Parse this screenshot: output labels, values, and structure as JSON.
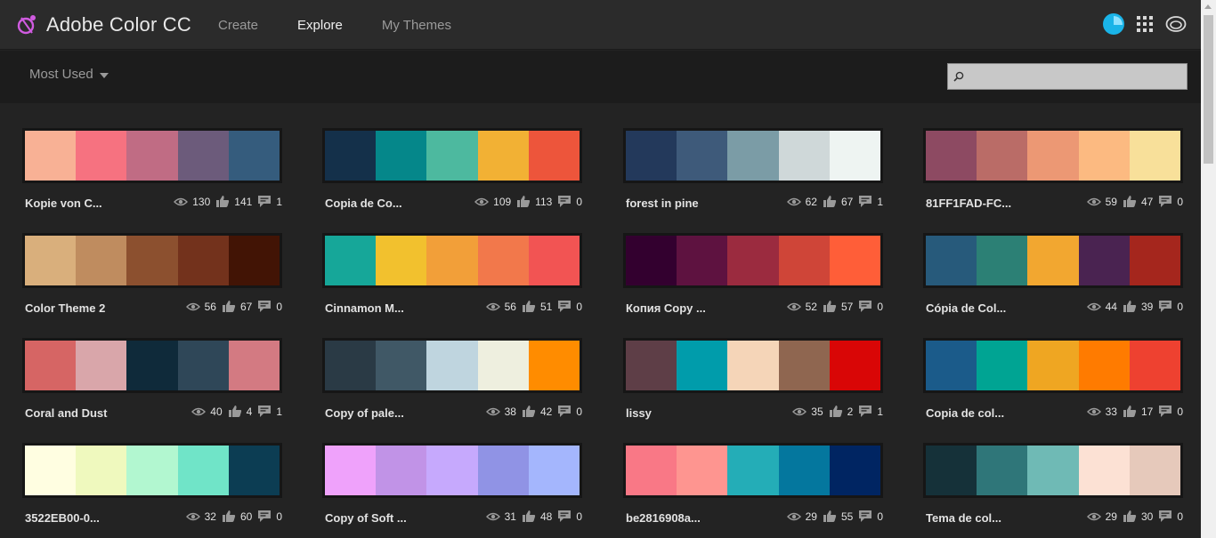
{
  "app": {
    "title": "Adobe Color CC",
    "nav": [
      {
        "label": "Create",
        "active": false
      },
      {
        "label": "Explore",
        "active": true
      },
      {
        "label": "My Themes",
        "active": false
      }
    ]
  },
  "toolbar": {
    "sort_label": "Most Used",
    "search_value": ""
  },
  "themes": [
    {
      "title": "Kopie von C...",
      "views": "130",
      "likes": "141",
      "comments": "1",
      "colors": [
        "#F8B195",
        "#F67280",
        "#C06C84",
        "#6C5B7B",
        "#355C7D"
      ]
    },
    {
      "title": "Copia de Co...",
      "views": "109",
      "likes": "113",
      "comments": "0",
      "colors": [
        "#14304A",
        "#05878A",
        "#4DB99F",
        "#F2B134",
        "#ED553B"
      ]
    },
    {
      "title": "forest in pine",
      "views": "62",
      "likes": "67",
      "comments": "1",
      "colors": [
        "#23395B",
        "#3E5A7A",
        "#7B9CA6",
        "#CFD8D9",
        "#EEF4F2"
      ]
    },
    {
      "title": "81FF1FAD-FC...",
      "views": "59",
      "likes": "47",
      "comments": "0",
      "colors": [
        "#8D4A62",
        "#BA6C67",
        "#EC9874",
        "#FCBA81",
        "#F8E09A"
      ]
    },
    {
      "title": "Color Theme 2",
      "views": "56",
      "likes": "67",
      "comments": "0",
      "colors": [
        "#D9AF7C",
        "#BF8C5F",
        "#8C502F",
        "#73321C",
        "#421405"
      ]
    },
    {
      "title": "Cinnamon M...",
      "views": "56",
      "likes": "51",
      "comments": "0",
      "colors": [
        "#16A799",
        "#F2C12E",
        "#F29F39",
        "#F2784B",
        "#F25453"
      ]
    },
    {
      "title": "Копия Copy ...",
      "views": "52",
      "likes": "57",
      "comments": "0",
      "colors": [
        "#33002F",
        "#5E1240",
        "#9B2B3F",
        "#CF4538",
        "#FF5E38"
      ]
    },
    {
      "title": "Cópia de Col...",
      "views": "44",
      "likes": "39",
      "comments": "0",
      "colors": [
        "#275A7B",
        "#2C8075",
        "#F2A730",
        "#4A2351",
        "#A5261D"
      ]
    },
    {
      "title": "Coral and Dust",
      "views": "40",
      "likes": "4",
      "comments": "1",
      "colors": [
        "#D66564",
        "#D9A6AA",
        "#0F2A3A",
        "#2F4758",
        "#D37A82"
      ]
    },
    {
      "title": "Copy of pale...",
      "views": "38",
      "likes": "42",
      "comments": "0",
      "colors": [
        "#2A3A45",
        "#405866",
        "#BFD5DF",
        "#EEEFDF",
        "#FF8C00"
      ]
    },
    {
      "title": "lissy",
      "views": "35",
      "likes": "2",
      "comments": "1",
      "colors": [
        "#5E3E47",
        "#009CAB",
        "#F5D5B8",
        "#8F6650",
        "#D90606"
      ]
    },
    {
      "title": "Copia de col...",
      "views": "33",
      "likes": "17",
      "comments": "0",
      "colors": [
        "#1B5B8A",
        "#00A493",
        "#EFA622",
        "#FF7B00",
        "#EE4130"
      ]
    },
    {
      "title": "3522EB00-0...",
      "views": "32",
      "likes": "60",
      "comments": "0",
      "colors": [
        "#FFFEE1",
        "#EFF9BE",
        "#B2F7D0",
        "#70E4C8",
        "#0C3D53"
      ]
    },
    {
      "title": "Copy of Soft ...",
      "views": "31",
      "likes": "48",
      "comments": "0",
      "colors": [
        "#EFA2FB",
        "#C193E7",
        "#C6A9FD",
        "#9093E5",
        "#A4B6FD"
      ]
    },
    {
      "title": "be2816908a...",
      "views": "29",
      "likes": "55",
      "comments": "0",
      "colors": [
        "#F97886",
        "#FE9590",
        "#24ADB7",
        "#04779E",
        "#002562"
      ]
    },
    {
      "title": "Tema de col...",
      "views": "29",
      "likes": "30",
      "comments": "0",
      "colors": [
        "#153139",
        "#2F7679",
        "#6FBAB5",
        "#FCE1D4",
        "#E6C9BB"
      ]
    }
  ]
}
